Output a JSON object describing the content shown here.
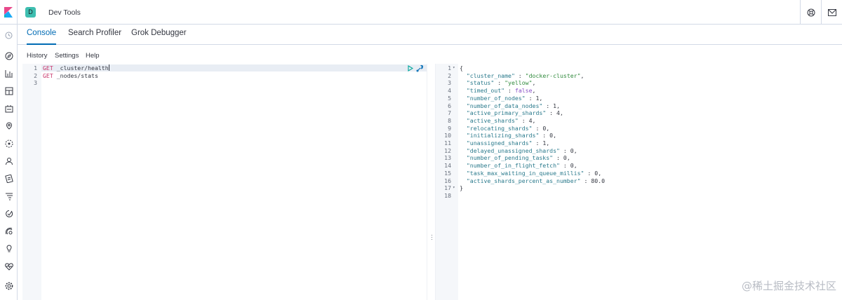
{
  "header": {
    "space_initial": "D",
    "app_title": "Dev Tools",
    "icons": [
      "help-icon",
      "mail-icon"
    ]
  },
  "tabs": [
    {
      "label": "Console",
      "active": true
    },
    {
      "label": "Search Profiler",
      "active": false
    },
    {
      "label": "Grok Debugger",
      "active": false
    }
  ],
  "toolbar": {
    "history": "History",
    "settings": "Settings",
    "help": "Help"
  },
  "request_editor": {
    "lines": [
      {
        "no": "1",
        "method": "GET",
        "path": " _cluster/health"
      },
      {
        "no": "2",
        "method": "GET",
        "path": " _nodes/stats"
      },
      {
        "no": "3",
        "method": "",
        "path": ""
      }
    ]
  },
  "response_editor": {
    "lines": [
      {
        "no": "1",
        "fold": true,
        "text": "{"
      },
      {
        "no": "2",
        "key": "\"cluster_name\"",
        "sep": " : ",
        "value": "\"docker-cluster\"",
        "type": "str",
        "end": ","
      },
      {
        "no": "3",
        "key": "\"status\"",
        "sep": " : ",
        "value": "\"yellow\"",
        "type": "str",
        "end": ","
      },
      {
        "no": "4",
        "key": "\"timed_out\"",
        "sep": " : ",
        "value": "false",
        "type": "bool",
        "end": ","
      },
      {
        "no": "5",
        "key": "\"number_of_nodes\"",
        "sep": " : ",
        "value": "1",
        "type": "num",
        "end": ","
      },
      {
        "no": "6",
        "key": "\"number_of_data_nodes\"",
        "sep": " : ",
        "value": "1",
        "type": "num",
        "end": ","
      },
      {
        "no": "7",
        "key": "\"active_primary_shards\"",
        "sep": " : ",
        "value": "4",
        "type": "num",
        "end": ","
      },
      {
        "no": "8",
        "key": "\"active_shards\"",
        "sep": " : ",
        "value": "4",
        "type": "num",
        "end": ","
      },
      {
        "no": "9",
        "key": "\"relocating_shards\"",
        "sep": " : ",
        "value": "0",
        "type": "num",
        "end": ","
      },
      {
        "no": "10",
        "key": "\"initializing_shards\"",
        "sep": " : ",
        "value": "0",
        "type": "num",
        "end": ","
      },
      {
        "no": "11",
        "key": "\"unassigned_shards\"",
        "sep": " : ",
        "value": "1",
        "type": "num",
        "end": ","
      },
      {
        "no": "12",
        "key": "\"delayed_unassigned_shards\"",
        "sep": " : ",
        "value": "0",
        "type": "num",
        "end": ","
      },
      {
        "no": "13",
        "key": "\"number_of_pending_tasks\"",
        "sep": " : ",
        "value": "0",
        "type": "num",
        "end": ","
      },
      {
        "no": "14",
        "key": "\"number_of_in_flight_fetch\"",
        "sep": " : ",
        "value": "0",
        "type": "num",
        "end": ","
      },
      {
        "no": "15",
        "key": "\"task_max_waiting_in_queue_millis\"",
        "sep": " : ",
        "value": "0",
        "type": "num",
        "end": ","
      },
      {
        "no": "16",
        "key": "\"active_shards_percent_as_number\"",
        "sep": " : ",
        "value": "80.0",
        "type": "num",
        "end": ""
      },
      {
        "no": "17",
        "fold": true,
        "text": "}"
      },
      {
        "no": "18",
        "text": ""
      }
    ]
  },
  "watermark": "@稀土掘金技术社区",
  "colors": {
    "accent": "#006bb4",
    "space_badge": "#3ebeb0",
    "method": "#c8346a",
    "json_key": "#2a7a8c",
    "json_string": "#308a3c"
  }
}
